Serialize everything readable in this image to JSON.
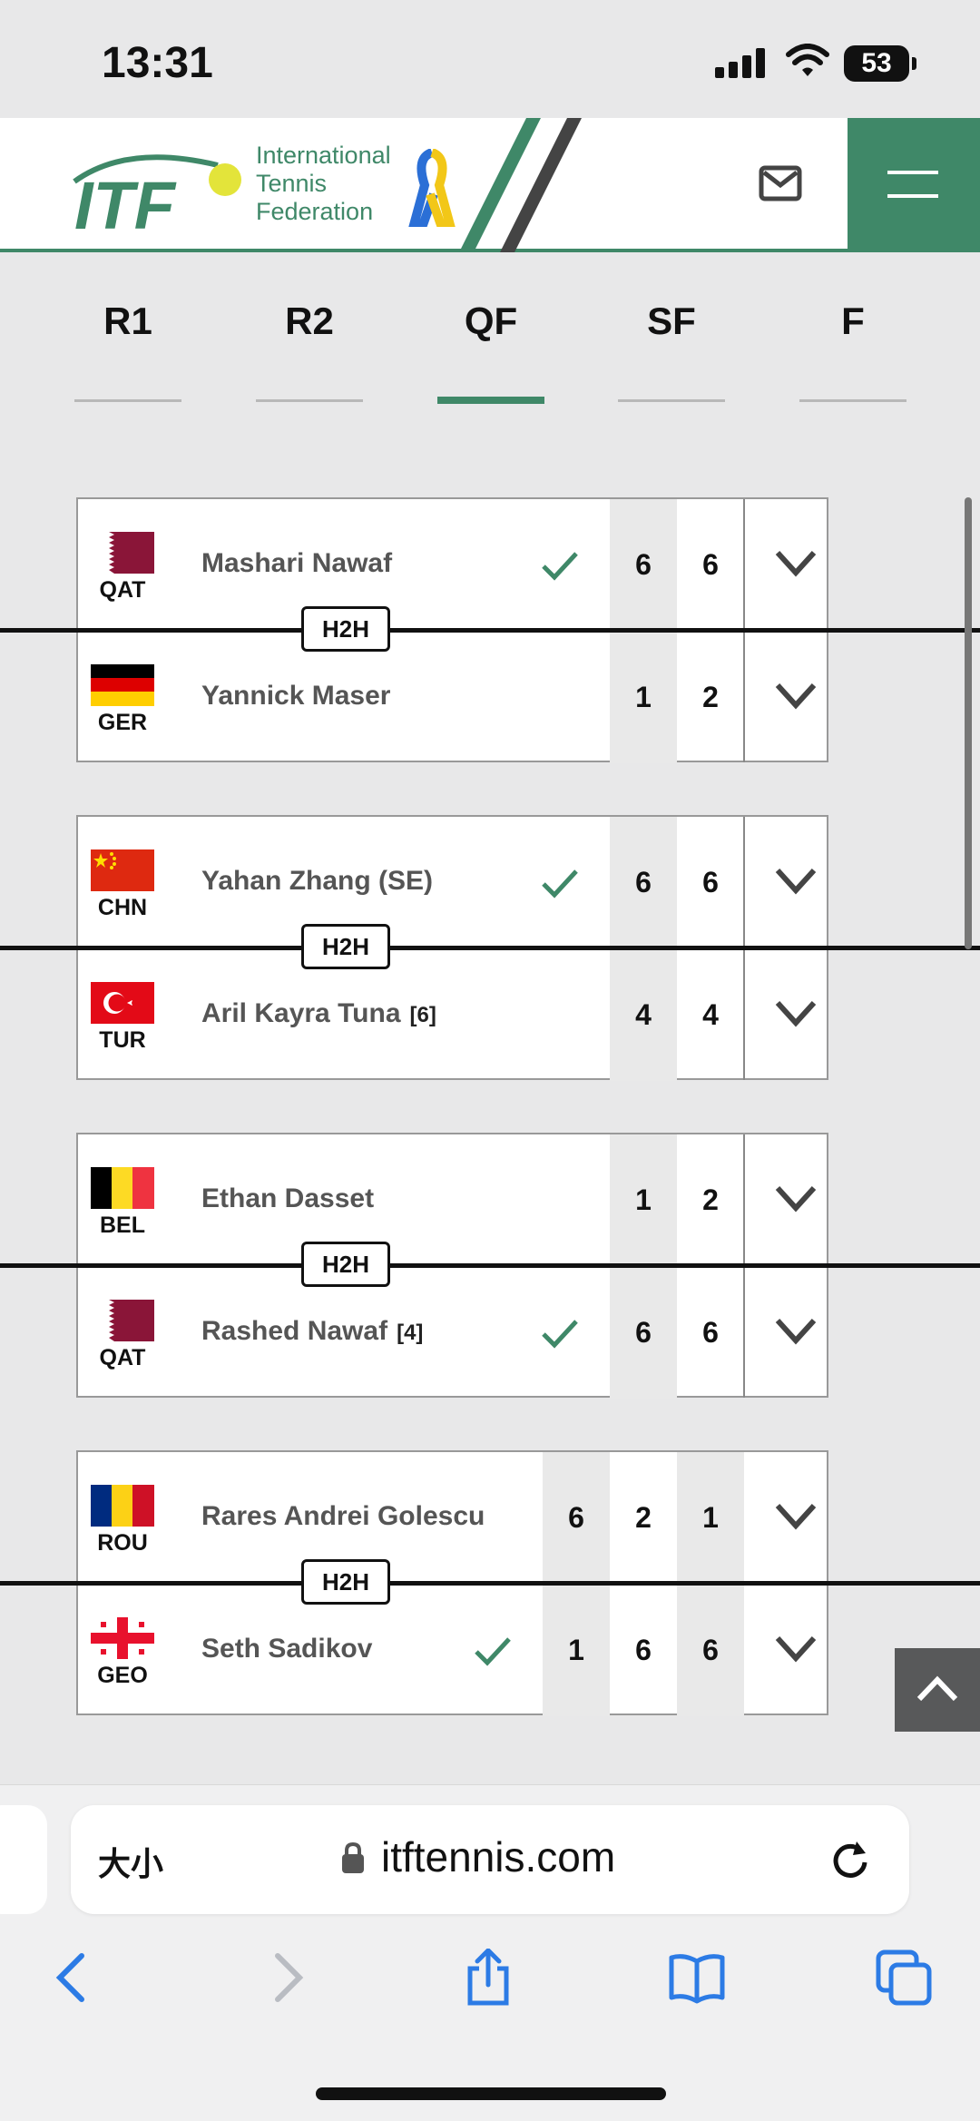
{
  "status": {
    "time": "13:31",
    "battery": "53"
  },
  "header": {
    "logo_text_1": "International",
    "logo_text_2": "Tennis",
    "logo_text_3": "Federation",
    "brand_color": "#3f8868"
  },
  "rounds": [
    {
      "label": "R1",
      "active": false
    },
    {
      "label": "R2",
      "active": false
    },
    {
      "label": "QF",
      "active": true
    },
    {
      "label": "SF",
      "active": false
    },
    {
      "label": "F",
      "active": false
    }
  ],
  "h2h_label": "H2H",
  "matches": [
    {
      "players": [
        {
          "code": "QAT",
          "name": "Mashari Nawaf",
          "seed": "",
          "winner": true,
          "scores": [
            "6",
            "6"
          ]
        },
        {
          "code": "GER",
          "name": "Yannick Maser",
          "seed": "",
          "winner": false,
          "scores": [
            "1",
            "2"
          ]
        }
      ]
    },
    {
      "players": [
        {
          "code": "CHN",
          "name": "Yahan Zhang (SE)",
          "seed": "",
          "winner": true,
          "scores": [
            "6",
            "6"
          ]
        },
        {
          "code": "TUR",
          "name": "Aril Kayra Tuna",
          "seed": "[6]",
          "winner": false,
          "scores": [
            "4",
            "4"
          ]
        }
      ]
    },
    {
      "players": [
        {
          "code": "BEL",
          "name": "Ethan Dasset",
          "seed": "",
          "winner": false,
          "scores": [
            "1",
            "2"
          ]
        },
        {
          "code": "QAT",
          "name": "Rashed Nawaf",
          "seed": "[4]",
          "winner": true,
          "scores": [
            "6",
            "6"
          ]
        }
      ]
    },
    {
      "players": [
        {
          "code": "ROU",
          "name": "Rares Andrei Golescu",
          "seed": "",
          "winner": false,
          "scores": [
            "6",
            "2",
            "1"
          ]
        },
        {
          "code": "GEO",
          "name": "Seth Sadikov",
          "seed": "",
          "winner": true,
          "scores": [
            "1",
            "6",
            "6"
          ]
        }
      ]
    }
  ],
  "browser": {
    "text_size": "大小",
    "url": "itftennis.com"
  }
}
